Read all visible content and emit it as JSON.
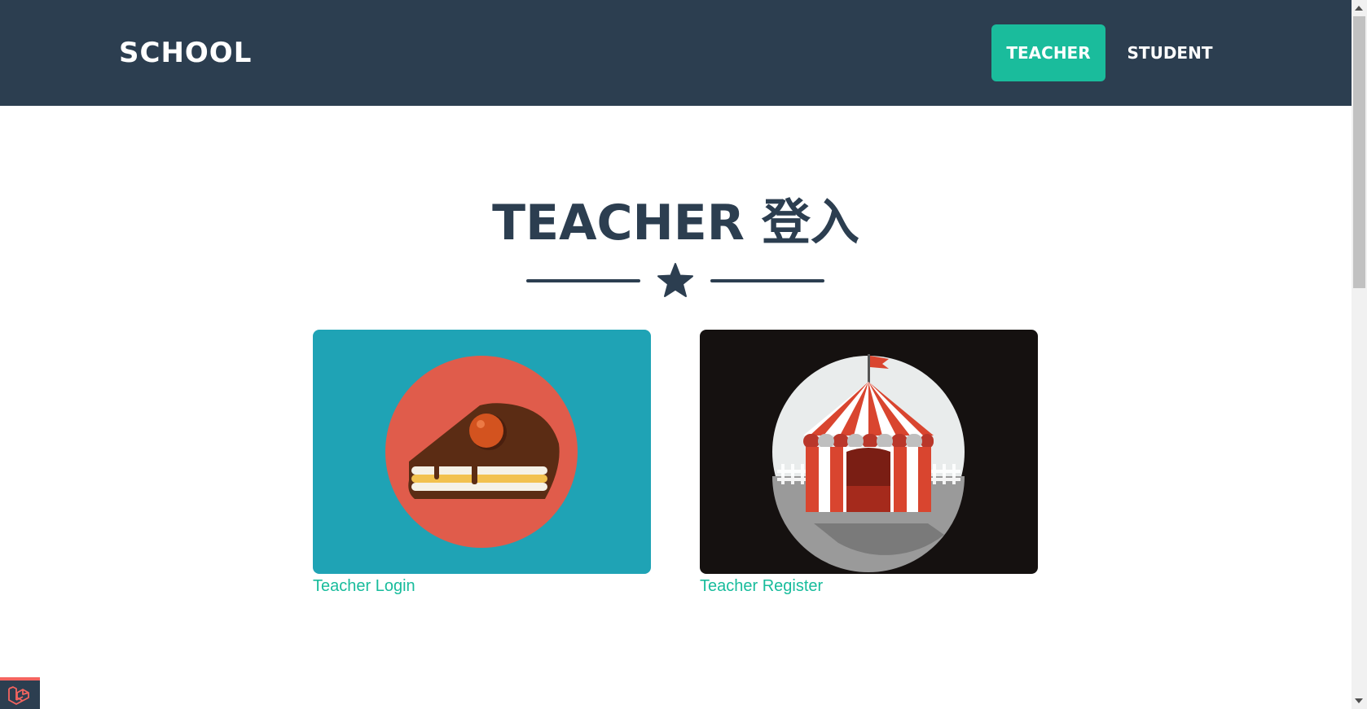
{
  "navbar": {
    "brand": "SCHOOL",
    "items": [
      {
        "label": "TEACHER",
        "active": true
      },
      {
        "label": "STUDENT",
        "active": false
      }
    ],
    "background_color": "#2c3e50",
    "active_color": "#1abc9c"
  },
  "main": {
    "title": "TEACHER 登入",
    "divider_icon": "star-icon",
    "cards": [
      {
        "link_label": "Teacher Login",
        "image": "cake-slice-icon",
        "background_color": "#1fa3b5"
      },
      {
        "link_label": "Teacher Register",
        "image": "circus-tent-icon",
        "background_color": "#151110"
      }
    ],
    "link_color": "#18bc9c"
  },
  "debug_bar": {
    "icon": "laravel-logo-icon"
  }
}
